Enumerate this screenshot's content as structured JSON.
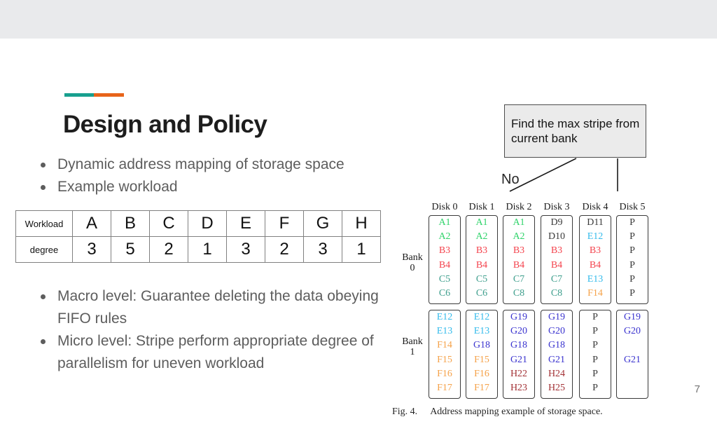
{
  "slide": {
    "page_number": "7",
    "title": "Design and Policy",
    "accent_colors": {
      "teal": "#18a08f",
      "orange": "#e8641a"
    },
    "bullets_top": [
      "Dynamic address mapping of storage space",
      "Example workload"
    ],
    "bullets_bottom": [
      "Macro level: Guarantee deleting the data obeying FIFO rules",
      "Micro level: Stripe perform appropriate degree of parallelism for uneven workload"
    ]
  },
  "callout": {
    "text": "Find the max stripe from current bank",
    "branch_label": "No"
  },
  "workload_table": {
    "row_labels": [
      "Workload",
      "degree"
    ],
    "workloads": [
      "A",
      "B",
      "C",
      "D",
      "E",
      "F",
      "G",
      "H"
    ],
    "degrees": [
      "3",
      "5",
      "2",
      "1",
      "3",
      "2",
      "3",
      "1"
    ]
  },
  "figure": {
    "caption_number": "Fig. 4.",
    "caption_text": "Address mapping example of storage space.",
    "disk_headers": [
      "Disk 0",
      "Disk 1",
      "Disk 2",
      "Disk 3",
      "Disk 4",
      "Disk 5"
    ],
    "bank_labels": [
      [
        "Bank",
        "0"
      ],
      [
        "Bank",
        "1"
      ]
    ],
    "stripe_colors": {
      "A": "#2fd36a",
      "B": "#f4444e",
      "C": "#3d9e8c",
      "D": "#3a3a3a",
      "E": "#34bbeb",
      "F": "#f5a24a",
      "G": "#3a33cf",
      "H": "#a33236",
      "P": "#3a3a3a"
    },
    "bank0": [
      [
        "A1",
        "A2",
        "B3",
        "B4",
        "C5",
        "C6"
      ],
      [
        "A1",
        "A2",
        "B3",
        "B4",
        "C5",
        "C6"
      ],
      [
        "A1",
        "A2",
        "B3",
        "B4",
        "C7",
        "C8"
      ],
      [
        "D9",
        "D10",
        "B3",
        "B4",
        "C7",
        "C8"
      ],
      [
        "D11",
        "E12",
        "B3",
        "B4",
        "E13",
        "F14"
      ],
      [
        "P",
        "P",
        "P",
        "P",
        "P",
        "P"
      ]
    ],
    "bank1": [
      [
        "E12",
        "E13",
        "F14",
        "F15",
        "F16",
        "F17"
      ],
      [
        "E12",
        "E13",
        "G18",
        "F15",
        "F16",
        "F17"
      ],
      [
        "G19",
        "G20",
        "G18",
        "G21",
        "H22",
        "H23"
      ],
      [
        "G19",
        "G20",
        "G18",
        "G21",
        "H24",
        "H25"
      ],
      [
        "P",
        "P",
        "P",
        "P",
        "P",
        "P"
      ],
      [
        "G19",
        "G20",
        "",
        "G21",
        "",
        ""
      ]
    ]
  }
}
